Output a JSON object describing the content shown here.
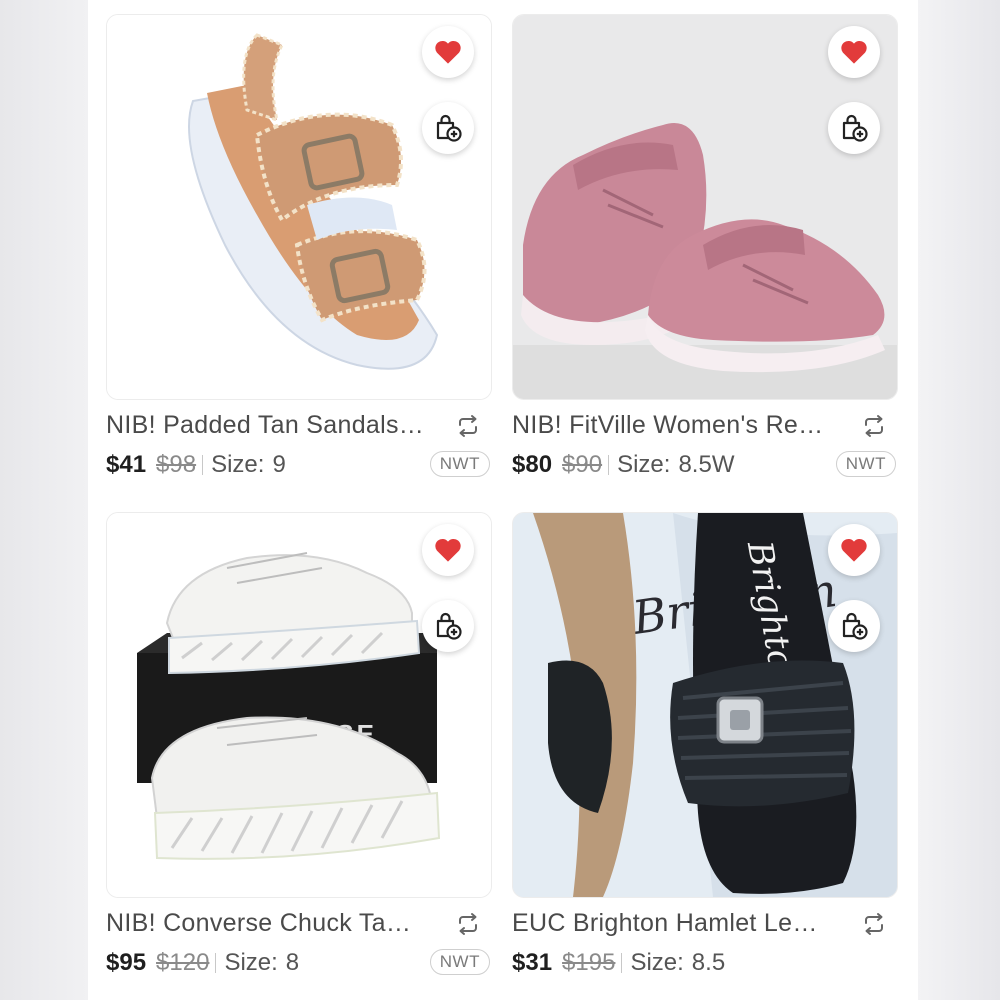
{
  "listings": [
    {
      "title": "NIB! Padded Tan Sandals…",
      "price": "$41",
      "original_price": "$98",
      "size_label": "Size:",
      "size_value": "9",
      "badge": "NWT",
      "liked": true,
      "image": "tan-buckle-platform-sandal"
    },
    {
      "title": "NIB! FitVille Women's Re…",
      "price": "$80",
      "original_price": "$90",
      "size_label": "Size:",
      "size_value": "8.5W",
      "badge": "NWT",
      "liked": true,
      "image": "pink-velcro-sneakers"
    },
    {
      "title": "NIB! Converse Chuck Ta…",
      "price": "$95",
      "original_price": "$120",
      "size_label": "Size:",
      "size_value": "8",
      "badge": "NWT",
      "liked": true,
      "image": "white-platform-converse-with-box",
      "box_text": "CONVERSE"
    },
    {
      "title": "EUC Brighton Hamlet Le…",
      "price": "$31",
      "original_price": "$195",
      "size_label": "Size:",
      "size_value": "8.5",
      "badge": "",
      "liked": true,
      "image": "black-woven-cork-wedge-slide",
      "insole_text": "Brighton",
      "bag_text": "Brighton"
    }
  ],
  "icons": {
    "like": "heart-icon",
    "bundle": "bag-plus-icon",
    "share": "repost-icon"
  },
  "colors": {
    "heart": "#e23b3b",
    "price": "#1f1f1f",
    "title": "#4a4a4a"
  }
}
